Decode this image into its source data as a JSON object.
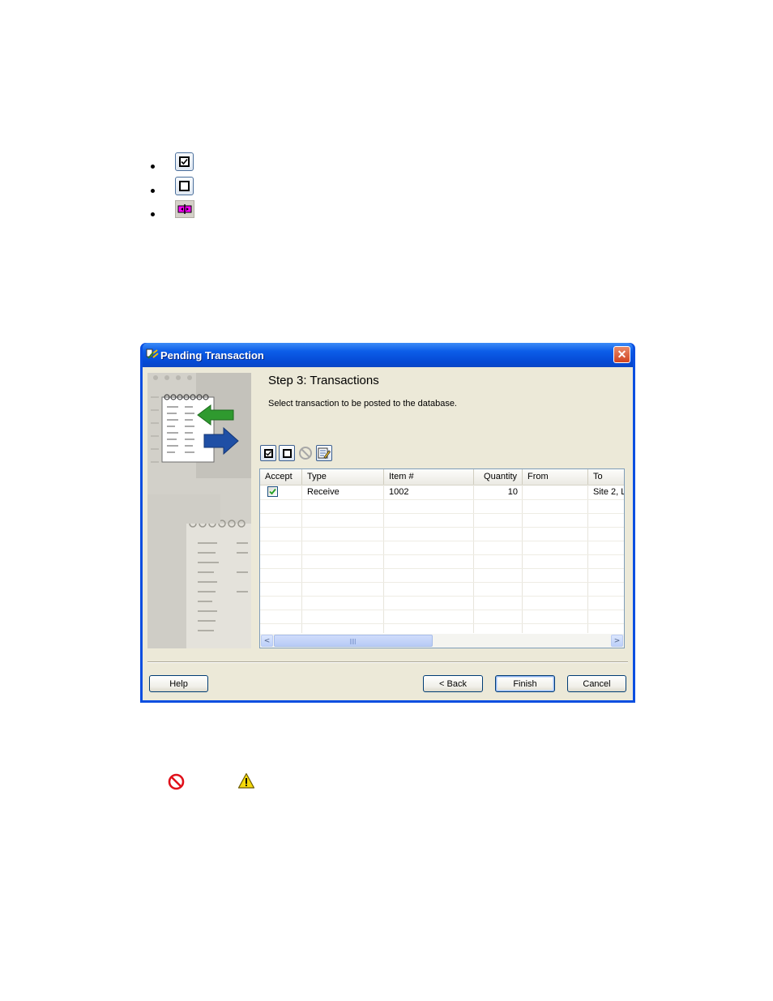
{
  "icons_list": [
    {
      "icon": "checked-box-icon"
    },
    {
      "icon": "unchecked-box-icon"
    },
    {
      "icon": "column-resize-icon"
    }
  ],
  "dialog": {
    "title": "Pending Transaction",
    "close_symbol": "✕",
    "heading": "Step 3: Transactions",
    "instruction": "Select transaction to be posted to the database.",
    "toolbar": [
      "check-all-icon",
      "uncheck-all-icon",
      "reject-icon",
      "edit-icon"
    ],
    "columns": [
      "Accept",
      "Type",
      "Item #",
      "Quantity",
      "From",
      "To"
    ],
    "rows": [
      {
        "accept": true,
        "type": "Receive",
        "item": "1002",
        "quantity": "10",
        "from": "",
        "to": "Site 2, L"
      }
    ],
    "scroll_left": "<",
    "scroll_right": ">",
    "buttons": {
      "help": "Help",
      "back": "< Back",
      "finish": "Finish",
      "cancel": "Cancel"
    }
  },
  "legend_icons": [
    "reject-icon",
    "warning-icon"
  ],
  "colors": {
    "titlebar": "#0549d4",
    "dialog_bg": "#ece9d8",
    "close_button": "#d1431f"
  }
}
